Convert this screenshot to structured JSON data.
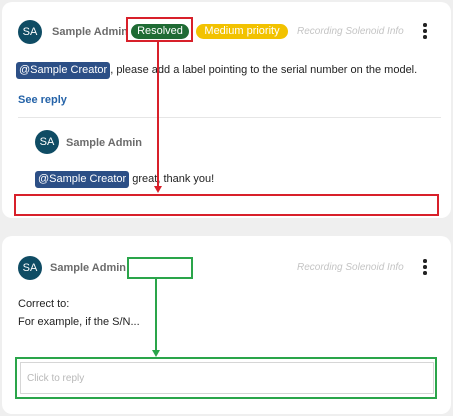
{
  "thread1": {
    "comment": {
      "avatar_initials": "SA",
      "author": "Sample Admin",
      "status_badge": "Resolved",
      "priority_badge": "Medium priority",
      "context": "Recording Solenoid Info",
      "mention": "@Sample Creator",
      "text": ", please add a label pointing to the serial number on the model."
    },
    "see_reply_label": "See reply",
    "reply": {
      "avatar_initials": "SA",
      "author": "Sample Admin",
      "mention": "@Sample Creator",
      "text": " great, thank you!"
    },
    "reply_field_value": ""
  },
  "thread2": {
    "comment": {
      "avatar_initials": "SA",
      "author": "Sample Admin",
      "context": "Recording Solenoid Info",
      "line1": "Correct to:",
      "line2": "For example, if the S/N..."
    },
    "reply_placeholder": "Click to reply"
  },
  "colors": {
    "avatar": "#0f4c64",
    "resolved": "#1f6b34",
    "priority": "#f2c200",
    "mention": "#2c4f86",
    "link": "#2563a8",
    "annotation_red": "#d8202a",
    "annotation_green": "#2aa54a"
  }
}
